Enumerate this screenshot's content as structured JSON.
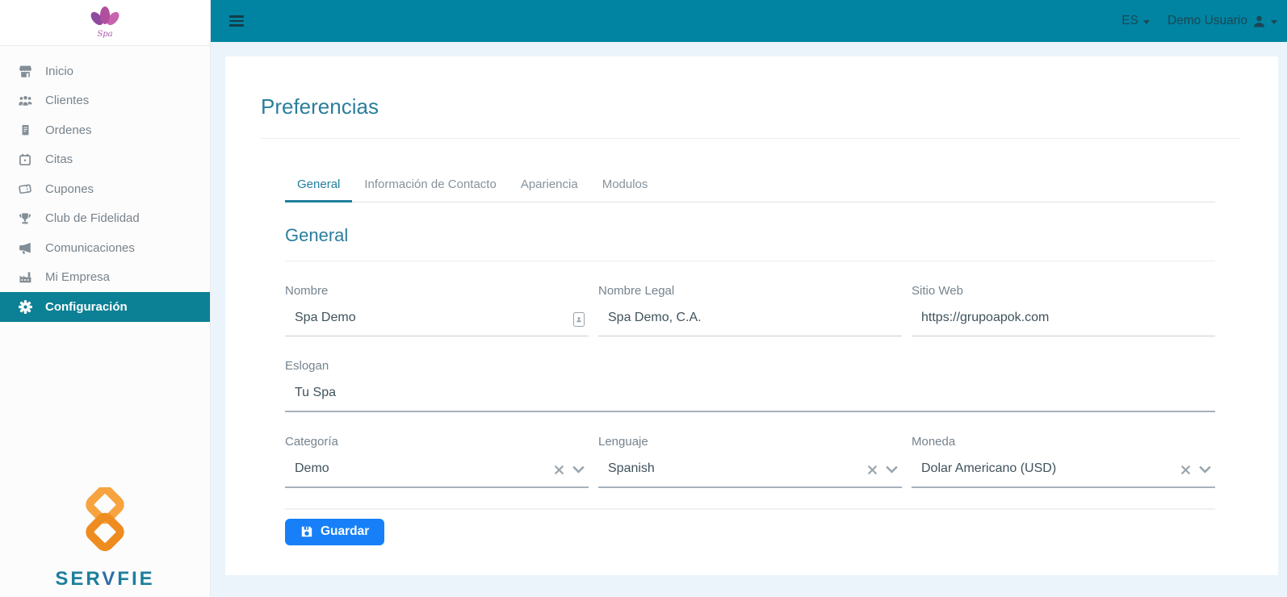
{
  "brand": {
    "logo_script": "Spa",
    "wordmark_pre": "SER",
    "wordmark_mid": "V",
    "wordmark_post": "FIE"
  },
  "topbar": {
    "language": "ES",
    "user_name": "Demo Usuario"
  },
  "sidebar": {
    "items": [
      {
        "label": "Inicio"
      },
      {
        "label": "Clientes"
      },
      {
        "label": "Ordenes"
      },
      {
        "label": "Citas"
      },
      {
        "label": "Cupones"
      },
      {
        "label": "Club de Fidelidad"
      },
      {
        "label": "Comunicaciones"
      },
      {
        "label": "Mi Empresa"
      },
      {
        "label": "Configuración",
        "active": true
      }
    ]
  },
  "page": {
    "title": "Preferencias"
  },
  "tabs": [
    {
      "label": "General",
      "active": true
    },
    {
      "label": "Información de Contacto",
      "active": false
    },
    {
      "label": "Apariencia",
      "active": false
    },
    {
      "label": "Modulos",
      "active": false
    }
  ],
  "section": {
    "title": "General"
  },
  "form": {
    "fields": {
      "nombre": {
        "label": "Nombre",
        "value": "Spa Demo"
      },
      "nombre_legal": {
        "label": "Nombre Legal",
        "value": "Spa Demo, C.A."
      },
      "sitio_web": {
        "label": "Sitio Web",
        "value": "https://grupoapok.com"
      },
      "eslogan": {
        "label": "Eslogan",
        "value": "Tu Spa"
      },
      "categoria": {
        "label": "Categoría",
        "value": "Demo"
      },
      "lenguaje": {
        "label": "Lenguaje",
        "value": "Spanish"
      },
      "moneda": {
        "label": "Moneda",
        "value": "Dolar Americano (USD)"
      }
    },
    "save_label": "Guardar"
  },
  "colors": {
    "topbar_teal": "#0084a2",
    "active_item_teal": "#0c8095",
    "heading_teal": "#2a7e9d",
    "tab_active_teal": "#1f809f",
    "button_blue": "#1780f8",
    "logo_orange_light": "#f7a340",
    "logo_orange_dark": "#ee8c1f",
    "wordmark_teal": "#1d7f9c",
    "wordmark_blue": "#2f6da8",
    "content_bg": "#ebf4fa"
  }
}
